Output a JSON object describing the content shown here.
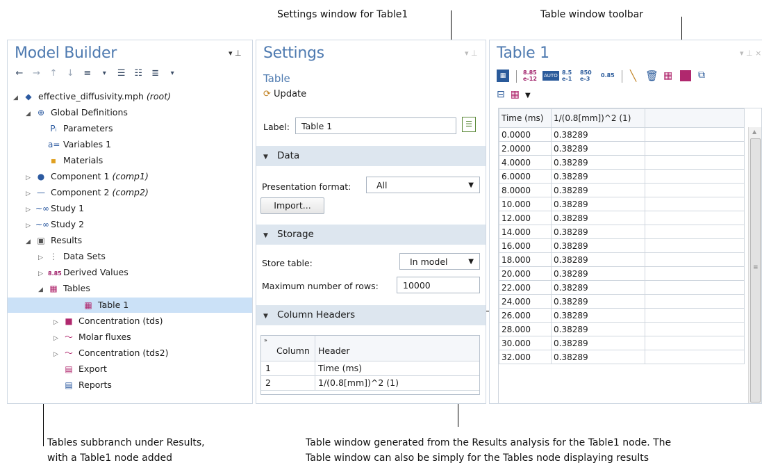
{
  "annotations": {
    "settings_window": "Settings window for Table1",
    "table_toolbar": "Table window toolbar",
    "tables_subbranch_line1": "Tables subbranch under Results,",
    "tables_subbranch_line2": "with a Table1 node added",
    "table_window_line1": "Table window generated from the Results analysis for the Table1 node. The",
    "table_window_line2": "Table window can also be simply for the Tables node displaying results"
  },
  "model_builder": {
    "title": "Model Builder",
    "tree": [
      {
        "label": "effective_diffusivity.mph",
        "suffix": "(root)",
        "icon": "root-diamond-icon"
      },
      {
        "label": "Global Definitions",
        "suffix": "",
        "icon": "globe-icon"
      },
      {
        "label": "Parameters",
        "suffix": "",
        "icon": "parameters-icon"
      },
      {
        "label": "Variables 1",
        "suffix": "",
        "icon": "variables-icon"
      },
      {
        "label": "Materials",
        "suffix": "",
        "icon": "materials-icon"
      },
      {
        "label": "Component 1",
        "suffix": "(comp1)",
        "icon": "component-icon"
      },
      {
        "label": "Component 2",
        "suffix": "(comp2)",
        "icon": "component-line-icon"
      },
      {
        "label": "Study 1",
        "suffix": "",
        "icon": "study-icon"
      },
      {
        "label": "Study 2",
        "suffix": "",
        "icon": "study-icon"
      },
      {
        "label": "Results",
        "suffix": "",
        "icon": "results-icon"
      },
      {
        "label": "Data Sets",
        "suffix": "",
        "icon": "datasets-icon"
      },
      {
        "label": "Derived Values",
        "suffix": "",
        "icon": "derived-values-icon"
      },
      {
        "label": "Tables",
        "suffix": "",
        "icon": "table-icon"
      },
      {
        "label": "Table 1",
        "suffix": "",
        "icon": "table-icon"
      },
      {
        "label": "Concentration (tds)",
        "suffix": "",
        "icon": "surface-plot-icon"
      },
      {
        "label": "Molar fluxes",
        "suffix": "",
        "icon": "line-plot-icon"
      },
      {
        "label": "Concentration (tds2)",
        "suffix": "",
        "icon": "line-plot-icon"
      },
      {
        "label": "Export",
        "suffix": "",
        "icon": "export-icon"
      },
      {
        "label": "Reports",
        "suffix": "",
        "icon": "reports-icon"
      }
    ]
  },
  "settings": {
    "title": "Settings",
    "subtitle": "Table",
    "update": "Update",
    "label_caption": "Label:",
    "label_value": "Table 1",
    "data_section": "Data",
    "presentation_caption": "Presentation format:",
    "presentation_value": "All",
    "import_button": "Import...",
    "storage_section": "Storage",
    "store_caption": "Store table:",
    "store_value": "In model",
    "max_rows_caption": "Maximum number of rows:",
    "max_rows_value": "10000",
    "column_headers_section": "Column Headers",
    "headers_table": {
      "col1": "Column",
      "col2": "Header",
      "rows": [
        {
          "column": "1",
          "header": "Time (ms)"
        },
        {
          "column": "2",
          "header": "1/(0.8[mm])^2 (1)"
        }
      ]
    }
  },
  "table_window": {
    "title": "Table 1",
    "toolbar_labels": {
      "num1": "8.85\ne-12",
      "auto": "AUTO",
      "num2": "8.5\ne-1",
      "num3": "850\ne-3",
      "num4": "0.85"
    },
    "col1": "Time (ms)",
    "col2": "1/(0.8[mm])^2 (1)",
    "rows": [
      [
        "0.0000",
        "0.38289"
      ],
      [
        "2.0000",
        "0.38289"
      ],
      [
        "4.0000",
        "0.38289"
      ],
      [
        "6.0000",
        "0.38289"
      ],
      [
        "8.0000",
        "0.38289"
      ],
      [
        "10.000",
        "0.38289"
      ],
      [
        "12.000",
        "0.38289"
      ],
      [
        "14.000",
        "0.38289"
      ],
      [
        "16.000",
        "0.38289"
      ],
      [
        "18.000",
        "0.38289"
      ],
      [
        "20.000",
        "0.38289"
      ],
      [
        "22.000",
        "0.38289"
      ],
      [
        "24.000",
        "0.38289"
      ],
      [
        "26.000",
        "0.38289"
      ],
      [
        "28.000",
        "0.38289"
      ],
      [
        "30.000",
        "0.38289"
      ],
      [
        "32.000",
        "0.38289"
      ]
    ]
  }
}
